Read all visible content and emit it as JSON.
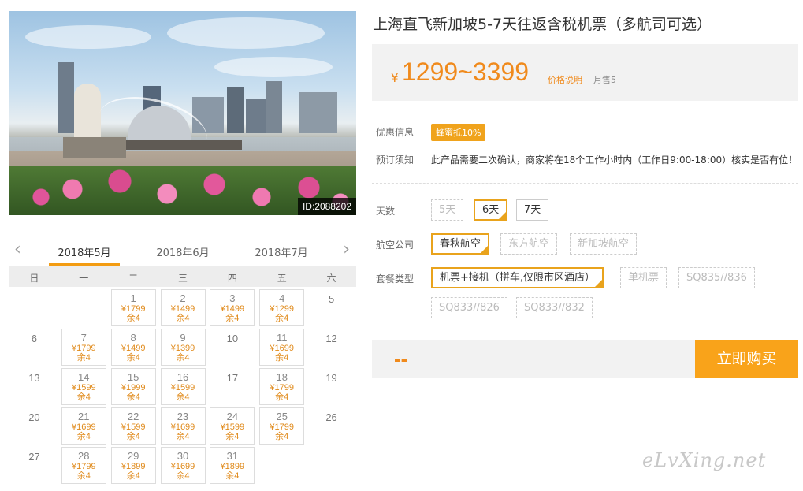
{
  "product": {
    "title": "上海直飞新加坡5-7天往返含税机票（多航司可选）",
    "photo_id": "ID:2088202",
    "currency_symbol": "¥",
    "price_range": "1299~3399",
    "price_note": "价格说明",
    "monthly_sales": "月售5"
  },
  "promo": {
    "label": "优惠信息",
    "tag": "蜂蜜抵10%"
  },
  "booking_notice": {
    "label": "预订须知",
    "text": "此产品需要二次确认，商家将在18个工作小时内（工作日9:00-18:00）核实是否有位！"
  },
  "options": {
    "days": {
      "label": "天数",
      "items": [
        {
          "text": "5天",
          "state": "disabled"
        },
        {
          "text": "6天",
          "state": "selected"
        },
        {
          "text": "7天",
          "state": "normal"
        }
      ]
    },
    "airline": {
      "label": "航空公司",
      "items": [
        {
          "text": "春秋航空",
          "state": "selected"
        },
        {
          "text": "东方航空",
          "state": "disabled"
        },
        {
          "text": "新加坡航空",
          "state": "disabled"
        }
      ]
    },
    "package": {
      "label": "套餐类型",
      "items": [
        {
          "text": "机票+接机（拼车,仅限市区酒店）",
          "state": "selected"
        },
        {
          "text": "单机票",
          "state": "disabled"
        },
        {
          "text": "SQ835//836",
          "state": "disabled"
        },
        {
          "text": "SQ833//826",
          "state": "disabled"
        },
        {
          "text": "SQ833//832",
          "state": "disabled"
        }
      ]
    }
  },
  "total_placeholder": "--",
  "buy_button": "立即购买",
  "calendar": {
    "months": [
      "2018年5月",
      "2018年6月",
      "2018年7月"
    ],
    "active_month": 0,
    "weekdays": [
      "日",
      "一",
      "二",
      "三",
      "四",
      "五",
      "六"
    ],
    "weeks": [
      [
        null,
        null,
        {
          "d": "1",
          "p": "¥1799",
          "r": "余4"
        },
        {
          "d": "2",
          "p": "¥1499",
          "r": "余4"
        },
        {
          "d": "3",
          "p": "¥1499",
          "r": "余4"
        },
        {
          "d": "4",
          "p": "¥1299",
          "r": "余4"
        },
        {
          "d": "5"
        }
      ],
      [
        {
          "d": "6"
        },
        {
          "d": "7",
          "p": "¥1799",
          "r": "余4"
        },
        {
          "d": "8",
          "p": "¥1499",
          "r": "余4"
        },
        {
          "d": "9",
          "p": "¥1399",
          "r": "余4"
        },
        {
          "d": "10"
        },
        {
          "d": "11",
          "p": "¥1699",
          "r": "余4"
        },
        {
          "d": "12"
        }
      ],
      [
        {
          "d": "13"
        },
        {
          "d": "14",
          "p": "¥1599",
          "r": "余4"
        },
        {
          "d": "15",
          "p": "¥1999",
          "r": "余4"
        },
        {
          "d": "16",
          "p": "¥1599",
          "r": "余4"
        },
        {
          "d": "17"
        },
        {
          "d": "18",
          "p": "¥1799",
          "r": "余4"
        },
        {
          "d": "19"
        }
      ],
      [
        {
          "d": "20"
        },
        {
          "d": "21",
          "p": "¥1699",
          "r": "余4"
        },
        {
          "d": "22",
          "p": "¥1599",
          "r": "余4"
        },
        {
          "d": "23",
          "p": "¥1699",
          "r": "余4"
        },
        {
          "d": "24",
          "p": "¥1599",
          "r": "余4"
        },
        {
          "d": "25",
          "p": "¥1799",
          "r": "余4"
        },
        {
          "d": "26"
        }
      ],
      [
        {
          "d": "27"
        },
        {
          "d": "28",
          "p": "¥1799",
          "r": "余4"
        },
        {
          "d": "29",
          "p": "¥1899",
          "r": "余4"
        },
        {
          "d": "30",
          "p": "¥1699",
          "r": "余4"
        },
        {
          "d": "31",
          "p": "¥1899",
          "r": "余4"
        },
        null,
        null
      ]
    ]
  },
  "watermark": "eLvXing.net",
  "colors": {
    "accent": "#f9a31a",
    "price": "#f08a1c"
  }
}
